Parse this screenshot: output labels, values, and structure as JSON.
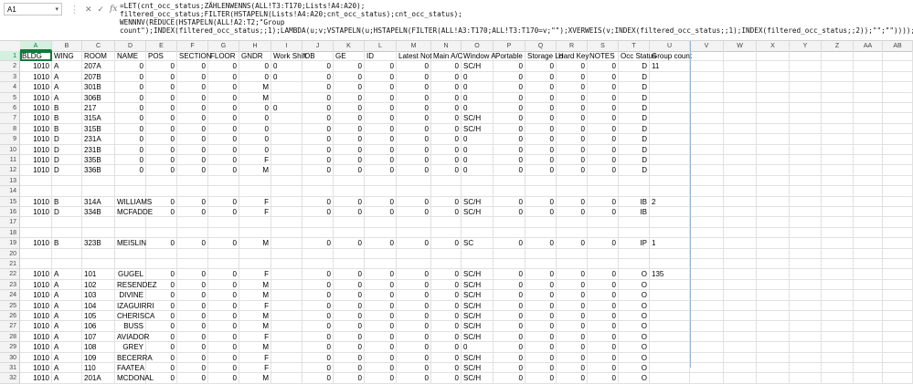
{
  "namebox": "A1",
  "formula_text": "=LET(cnt_occ_status;ZÄHLENWENNS(ALL!T3:T170;Lists!A4:A20);\nfiltered_occ_status;FILTER(HSTAPELN(Lists!A4:A20;cnt_occ_status);cnt_occ_status);\nWENNNV(REDUCE(HSTAPELN(ALL!A2:T2;\"Group\ncount\");INDEX(filtered_occ_status;;1);LAMBDA(u;v;VSTAPELN(u;HSTAPELN(FILTER(ALL!A3:T170;ALL!T3:T170=v;\"\");XVERWEIS(v;INDEX(filtered_occ_status;;1);INDEX(filtered_occ_status;;2));\"\";\"\"))));\"\"))",
  "columns": [
    "A",
    "B",
    "C",
    "D",
    "E",
    "F",
    "G",
    "H",
    "I",
    "J",
    "K",
    "L",
    "M",
    "N",
    "O",
    "P",
    "Q",
    "R",
    "S",
    "T",
    "U",
    "V",
    "W",
    "X",
    "Y",
    "Z",
    "AA",
    "AB"
  ],
  "header_row": [
    "BLDG",
    "WING",
    "ROOM",
    "NAME",
    "POS",
    "SECTION",
    "FLOOR",
    "GNDR",
    "Work Shift",
    "OB",
    "GE",
    "ID",
    "Latest Not",
    "Main A/C",
    "Window A",
    "Portable",
    "Storage Lo",
    "Hard Key",
    "NOTES",
    "Occ Status",
    "Group count"
  ],
  "rows": [
    {
      "n": "2",
      "c": [
        "1010",
        "A",
        "207A",
        "0",
        "0",
        "0",
        "0",
        "0",
        "0",
        "0",
        "0",
        "0",
        "0",
        "0",
        "SC/H",
        "0",
        "0",
        "0",
        "0",
        "0",
        "D",
        "11"
      ]
    },
    {
      "n": "3",
      "c": [
        "1010",
        "A",
        "207B",
        "0",
        "0",
        "0",
        "0",
        "0",
        "0",
        "0",
        "0",
        "0",
        "0",
        "0",
        "0",
        "0",
        "0",
        "0",
        "0",
        "0",
        "D",
        ""
      ]
    },
    {
      "n": "4",
      "c": [
        "1010",
        "A",
        "301B",
        "0",
        "0",
        "0",
        "0",
        "M",
        "",
        "0",
        "0",
        "0",
        "0",
        "0",
        "0",
        "0",
        "0",
        "0",
        "0",
        "0",
        "D",
        ""
      ]
    },
    {
      "n": "5",
      "c": [
        "1010",
        "A",
        "306B",
        "0",
        "0",
        "0",
        "0",
        "M",
        "",
        "0",
        "0",
        "0",
        "0",
        "0",
        "0",
        "0",
        "0",
        "0",
        "0",
        "0",
        "D",
        ""
      ]
    },
    {
      "n": "6",
      "c": [
        "1010",
        "B",
        "217",
        "0",
        "0",
        "0",
        "0",
        "0",
        "0",
        "0",
        "0",
        "0",
        "0",
        "0",
        "0",
        "0",
        "0",
        "0",
        "0",
        "0",
        "D",
        ""
      ]
    },
    {
      "n": "7",
      "c": [
        "1010",
        "B",
        "315A",
        "0",
        "0",
        "0",
        "0",
        "0",
        "",
        "0",
        "0",
        "0",
        "0",
        "0",
        "SC/H",
        "0",
        "0",
        "0",
        "0",
        "0",
        "D",
        ""
      ]
    },
    {
      "n": "8",
      "c": [
        "1010",
        "B",
        "315B",
        "0",
        "0",
        "0",
        "0",
        "0",
        "",
        "0",
        "0",
        "0",
        "0",
        "0",
        "SC/H",
        "0",
        "0",
        "0",
        "0",
        "0",
        "D",
        ""
      ]
    },
    {
      "n": "9",
      "c": [
        "1010",
        "D",
        "231A",
        "0",
        "0",
        "0",
        "0",
        "0",
        "",
        "0",
        "0",
        "0",
        "0",
        "0",
        "0",
        "0",
        "0",
        "0",
        "0",
        "0",
        "D",
        ""
      ]
    },
    {
      "n": "10",
      "c": [
        "1010",
        "D",
        "231B",
        "0",
        "0",
        "0",
        "0",
        "0",
        "",
        "0",
        "0",
        "0",
        "0",
        "0",
        "0",
        "0",
        "0",
        "0",
        "0",
        "0",
        "D",
        ""
      ]
    },
    {
      "n": "11",
      "c": [
        "1010",
        "D",
        "335B",
        "0",
        "0",
        "0",
        "0",
        "F",
        "",
        "0",
        "0",
        "0",
        "0",
        "0",
        "0",
        "0",
        "0",
        "0",
        "0",
        "0",
        "D",
        ""
      ]
    },
    {
      "n": "12",
      "c": [
        "1010",
        "D",
        "336B",
        "0",
        "0",
        "0",
        "0",
        "M",
        "",
        "0",
        "0",
        "0",
        "0",
        "0",
        "0",
        "0",
        "0",
        "0",
        "0",
        "0",
        "D",
        ""
      ]
    },
    {
      "n": "13",
      "c": [
        "",
        "",
        "",
        "",
        "",
        "",
        "",
        "",
        "",
        "",
        "",
        "",
        "",
        "",
        "",
        "",
        "",
        "",
        "",
        "",
        "",
        ""
      ]
    },
    {
      "n": "14",
      "c": [
        "",
        "",
        "",
        "",
        "",
        "",
        "",
        "",
        "",
        "",
        "",
        "",
        "",
        "",
        "",
        "",
        "",
        "",
        "",
        "",
        "",
        ""
      ]
    },
    {
      "n": "15",
      "c": [
        "1010",
        "B",
        "314A",
        "WILLIAMS",
        "0",
        "0",
        "0",
        "F",
        "",
        "0",
        "0",
        "0",
        "0",
        "0",
        "SC/H",
        "0",
        "0",
        "0",
        "0",
        "0",
        "IB",
        "2"
      ]
    },
    {
      "n": "16",
      "c": [
        "1010",
        "D",
        "334B",
        "MCFADDE",
        "0",
        "0",
        "0",
        "F",
        "",
        "0",
        "0",
        "0",
        "0",
        "0",
        "SC/H",
        "0",
        "0",
        "0",
        "0",
        "0",
        "IB",
        ""
      ]
    },
    {
      "n": "17",
      "c": [
        "",
        "",
        "",
        "",
        "",
        "",
        "",
        "",
        "",
        "",
        "",
        "",
        "",
        "",
        "",
        "",
        "",
        "",
        "",
        "",
        "",
        ""
      ]
    },
    {
      "n": "18",
      "c": [
        "",
        "",
        "",
        "",
        "",
        "",
        "",
        "",
        "",
        "",
        "",
        "",
        "",
        "",
        "",
        "",
        "",
        "",
        "",
        "",
        "",
        ""
      ]
    },
    {
      "n": "19",
      "c": [
        "1010",
        "B",
        "323B",
        "MEISLIN",
        "0",
        "0",
        "0",
        "M",
        "",
        "0",
        "0",
        "0",
        "0",
        "0",
        "SC",
        "0",
        "0",
        "0",
        "0",
        "0",
        "IP",
        "1"
      ]
    },
    {
      "n": "20",
      "c": [
        "",
        "",
        "",
        "",
        "",
        "",
        "",
        "",
        "",
        "",
        "",
        "",
        "",
        "",
        "",
        "",
        "",
        "",
        "",
        "",
        "",
        ""
      ]
    },
    {
      "n": "21",
      "c": [
        "",
        "",
        "",
        "",
        "",
        "",
        "",
        "",
        "",
        "",
        "",
        "",
        "",
        "",
        "",
        "",
        "",
        "",
        "",
        "",
        "",
        ""
      ]
    },
    {
      "n": "22",
      "c": [
        "1010",
        "A",
        "101",
        "GUGEL",
        "0",
        "0",
        "0",
        "F",
        "",
        "0",
        "0",
        "0",
        "0",
        "0",
        "SC/H",
        "0",
        "0",
        "0",
        "0",
        "0",
        "O",
        "135"
      ]
    },
    {
      "n": "23",
      "c": [
        "1010",
        "A",
        "102",
        "RESENDEZ",
        "0",
        "0",
        "0",
        "M",
        "",
        "0",
        "0",
        "0",
        "0",
        "0",
        "SC/H",
        "0",
        "0",
        "0",
        "0",
        "0",
        "O",
        ""
      ]
    },
    {
      "n": "24",
      "c": [
        "1010",
        "A",
        "103",
        "DIVINE",
        "0",
        "0",
        "0",
        "M",
        "",
        "0",
        "0",
        "0",
        "0",
        "0",
        "SC/H",
        "0",
        "0",
        "0",
        "0",
        "0",
        "O",
        ""
      ]
    },
    {
      "n": "25",
      "c": [
        "1010",
        "A",
        "104",
        "IZAGUIRRI",
        "0",
        "0",
        "0",
        "F",
        "",
        "0",
        "0",
        "0",
        "0",
        "0",
        "SC/H",
        "0",
        "0",
        "0",
        "0",
        "0",
        "O",
        ""
      ]
    },
    {
      "n": "26",
      "c": [
        "1010",
        "A",
        "105",
        "CHERISCA",
        "0",
        "0",
        "0",
        "M",
        "",
        "0",
        "0",
        "0",
        "0",
        "0",
        "SC/H",
        "0",
        "0",
        "0",
        "0",
        "0",
        "O",
        ""
      ]
    },
    {
      "n": "27",
      "c": [
        "1010",
        "A",
        "106",
        "BUSS",
        "0",
        "0",
        "0",
        "M",
        "",
        "0",
        "0",
        "0",
        "0",
        "0",
        "SC/H",
        "0",
        "0",
        "0",
        "0",
        "0",
        "O",
        ""
      ]
    },
    {
      "n": "28",
      "c": [
        "1010",
        "A",
        "107",
        "AVIADOR",
        "0",
        "0",
        "0",
        "F",
        "",
        "0",
        "0",
        "0",
        "0",
        "0",
        "SC/H",
        "0",
        "0",
        "0",
        "0",
        "0",
        "O",
        ""
      ]
    },
    {
      "n": "29",
      "c": [
        "1010",
        "A",
        "108",
        "GREY",
        "0",
        "0",
        "0",
        "M",
        "",
        "0",
        "0",
        "0",
        "0",
        "0",
        "0",
        "0",
        "0",
        "0",
        "0",
        "0",
        "O",
        ""
      ]
    },
    {
      "n": "30",
      "c": [
        "1010",
        "A",
        "109",
        "BECERRA",
        "0",
        "0",
        "0",
        "F",
        "",
        "0",
        "0",
        "0",
        "0",
        "0",
        "SC/H",
        "0",
        "0",
        "0",
        "0",
        "0",
        "O",
        ""
      ]
    },
    {
      "n": "31",
      "c": [
        "1010",
        "A",
        "110",
        "FAATEA",
        "0",
        "0",
        "0",
        "F",
        "",
        "0",
        "0",
        "0",
        "0",
        "0",
        "SC/H",
        "0",
        "0",
        "0",
        "0",
        "0",
        "O",
        ""
      ]
    },
    {
      "n": "32",
      "c": [
        "1010",
        "A",
        "201A",
        "MCDONAL",
        "0",
        "0",
        "0",
        "M",
        "",
        "0",
        "0",
        "0",
        "0",
        "0",
        "SC/H",
        "0",
        "0",
        "0",
        "0",
        "0",
        "O",
        ""
      ]
    }
  ]
}
